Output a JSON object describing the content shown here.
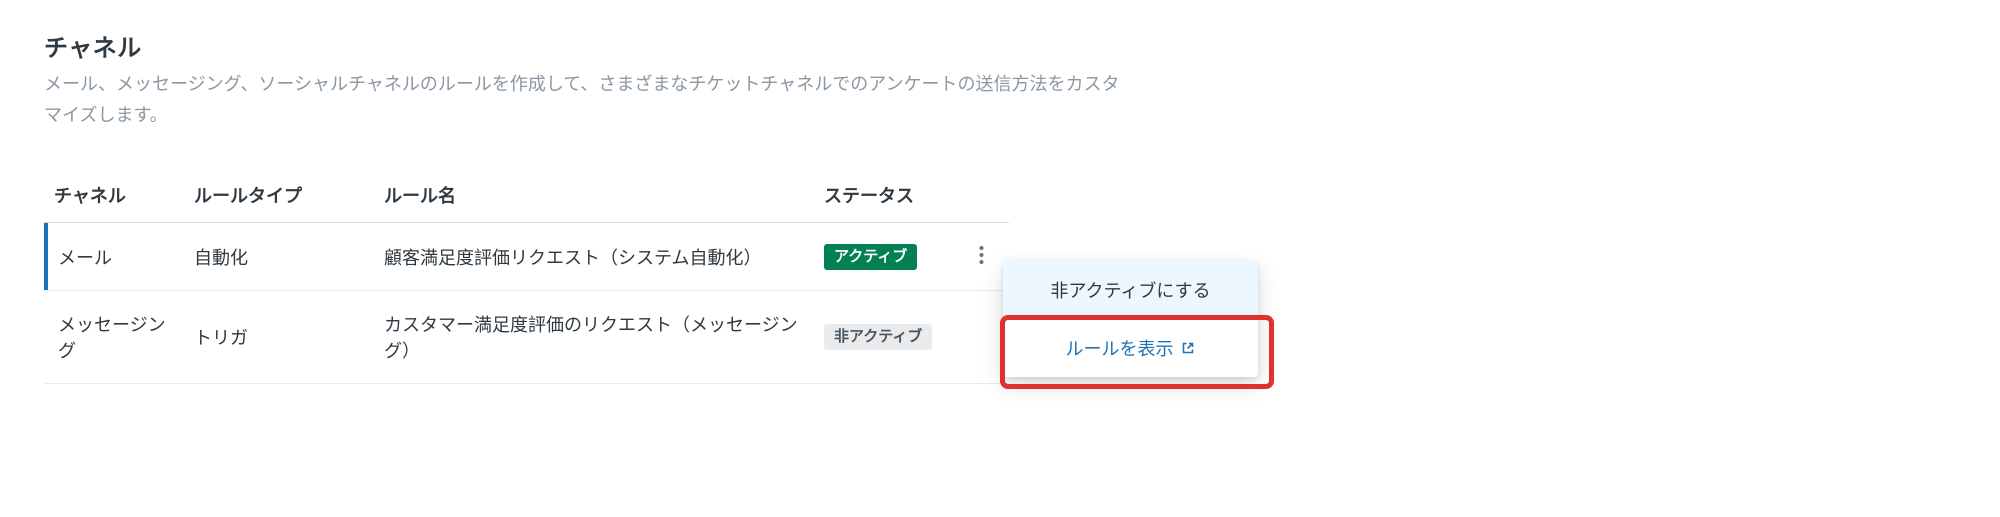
{
  "section": {
    "title": "チャネル",
    "description": "メール、メッセージング、ソーシャルチャネルのルールを作成して、さまざまなチケットチャネルでのアンケートの送信方法をカスタマイズします。"
  },
  "table": {
    "headers": {
      "channel": "チャネル",
      "rule_type": "ルールタイプ",
      "rule_name": "ルール名",
      "status": "ステータス"
    },
    "rows": [
      {
        "channel": "メール",
        "rule_type": "自動化",
        "rule_name": "顧客満足度評価リクエスト（システム自動化）",
        "status_label": "アクティブ",
        "status_kind": "active"
      },
      {
        "channel": "メッセージング",
        "rule_type": "トリガ",
        "rule_name": "カスタマー満足度評価のリクエスト（メッセージング）",
        "status_label": "非アクティブ",
        "status_kind": "inactive"
      }
    ]
  },
  "dropdown": {
    "deactivate": "非アクティブにする",
    "view_rule": "ルールを表示"
  }
}
